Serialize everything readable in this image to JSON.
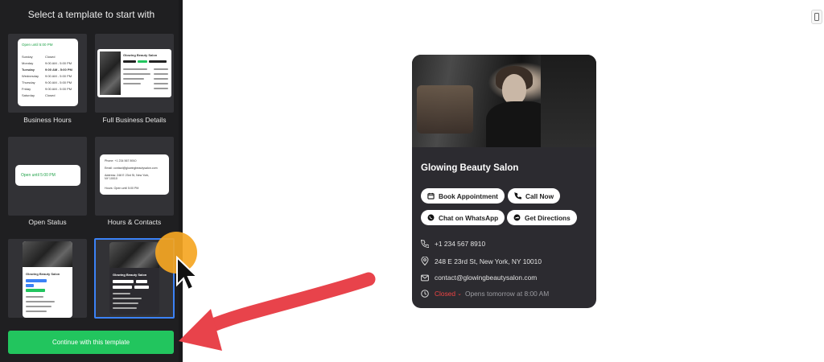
{
  "sidebar": {
    "title": "Select a template to start with",
    "continue_label": "Continue with this template",
    "templates": [
      {
        "label": "Business Hours"
      },
      {
        "label": "Full Business Details"
      },
      {
        "label": "Open Status"
      },
      {
        "label": "Hours & Contacts"
      },
      {
        "label": ""
      },
      {
        "label": ""
      }
    ],
    "thumb_business_hours": {
      "status": "Open until 5:00 PM",
      "days": [
        "Sunday",
        "Monday",
        "Tuesday",
        "Wednesday",
        "Thursday",
        "Friday",
        "Saturday"
      ],
      "hours": [
        "Closed",
        "9:00 AM - 5:00 PM",
        "9:00 AM - 5:00 PM",
        "9:00 AM - 5:00 PM",
        "9:00 AM - 5:00 PM",
        "9:00 AM - 5:00 PM",
        "Closed"
      ]
    },
    "thumb_full_business": {
      "name": "Glowing Beauty Salon"
    },
    "thumb_open_status": {
      "status": "Open until 5:00 PM"
    },
    "thumb_hours_contacts": {
      "rows": [
        "Phone: +1 234 567 8910",
        "Email: contact@glowingbeautysalon.com",
        "Address: 248 E 23rd St, New York, NY 10010",
        "Hours: Open until 5:00 PM"
      ]
    },
    "thumb_light_card": {
      "name": "Glowing Beauty Salon"
    },
    "thumb_dark_card": {
      "name": "Glowing Beauty Salon"
    }
  },
  "preview": {
    "business_name": "Glowing Beauty Salon",
    "buttons": {
      "book": "Book Appointment",
      "call": "Call Now",
      "whatsapp": "Chat on WhatsApp",
      "directions": "Get Directions"
    },
    "phone": "+1 234 567 8910",
    "address": "248 E 23rd St, New York, NY 10010",
    "email": "contact@glowingbeautysalon.com",
    "status": "Closed",
    "status_detail": "Opens tomorrow at 8:00 AM"
  },
  "colors": {
    "sidebar_bg": "#1f1f21",
    "card_bg": "#2c2b30",
    "accent_green": "#22c55e",
    "selected_border": "#3b82f6",
    "closed_red": "#ef4444",
    "cursor_dot": "#f5a623",
    "arrow_red": "#e8434b"
  },
  "icons": [
    "calendar-icon",
    "phone-icon",
    "whatsapp-icon",
    "directions-icon",
    "location-icon",
    "mail-icon",
    "clock-icon",
    "device-toggle-icon",
    "mouse-cursor-icon"
  ]
}
